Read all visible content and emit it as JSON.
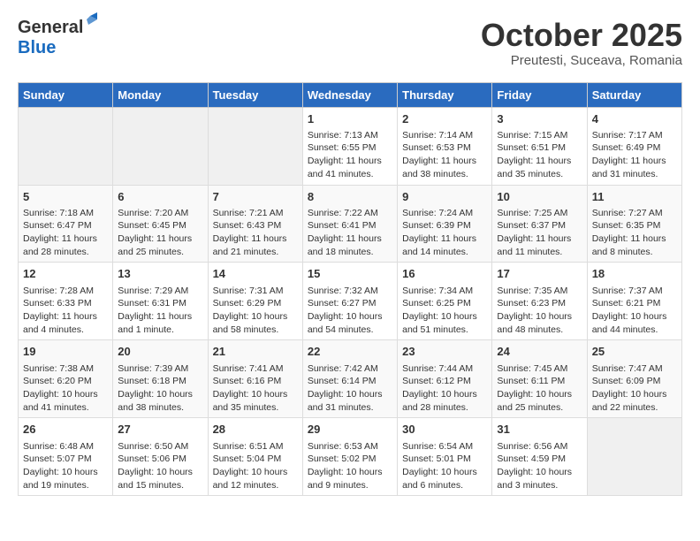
{
  "logo": {
    "general": "General",
    "blue": "Blue"
  },
  "title": "October 2025",
  "subtitle": "Preutesti, Suceava, Romania",
  "headers": [
    "Sunday",
    "Monday",
    "Tuesday",
    "Wednesday",
    "Thursday",
    "Friday",
    "Saturday"
  ],
  "weeks": [
    [
      {
        "day": "",
        "info": ""
      },
      {
        "day": "",
        "info": ""
      },
      {
        "day": "",
        "info": ""
      },
      {
        "day": "1",
        "info": "Sunrise: 7:13 AM\nSunset: 6:55 PM\nDaylight: 11 hours and 41 minutes."
      },
      {
        "day": "2",
        "info": "Sunrise: 7:14 AM\nSunset: 6:53 PM\nDaylight: 11 hours and 38 minutes."
      },
      {
        "day": "3",
        "info": "Sunrise: 7:15 AM\nSunset: 6:51 PM\nDaylight: 11 hours and 35 minutes."
      },
      {
        "day": "4",
        "info": "Sunrise: 7:17 AM\nSunset: 6:49 PM\nDaylight: 11 hours and 31 minutes."
      }
    ],
    [
      {
        "day": "5",
        "info": "Sunrise: 7:18 AM\nSunset: 6:47 PM\nDaylight: 11 hours and 28 minutes."
      },
      {
        "day": "6",
        "info": "Sunrise: 7:20 AM\nSunset: 6:45 PM\nDaylight: 11 hours and 25 minutes."
      },
      {
        "day": "7",
        "info": "Sunrise: 7:21 AM\nSunset: 6:43 PM\nDaylight: 11 hours and 21 minutes."
      },
      {
        "day": "8",
        "info": "Sunrise: 7:22 AM\nSunset: 6:41 PM\nDaylight: 11 hours and 18 minutes."
      },
      {
        "day": "9",
        "info": "Sunrise: 7:24 AM\nSunset: 6:39 PM\nDaylight: 11 hours and 14 minutes."
      },
      {
        "day": "10",
        "info": "Sunrise: 7:25 AM\nSunset: 6:37 PM\nDaylight: 11 hours and 11 minutes."
      },
      {
        "day": "11",
        "info": "Sunrise: 7:27 AM\nSunset: 6:35 PM\nDaylight: 11 hours and 8 minutes."
      }
    ],
    [
      {
        "day": "12",
        "info": "Sunrise: 7:28 AM\nSunset: 6:33 PM\nDaylight: 11 hours and 4 minutes."
      },
      {
        "day": "13",
        "info": "Sunrise: 7:29 AM\nSunset: 6:31 PM\nDaylight: 11 hours and 1 minute."
      },
      {
        "day": "14",
        "info": "Sunrise: 7:31 AM\nSunset: 6:29 PM\nDaylight: 10 hours and 58 minutes."
      },
      {
        "day": "15",
        "info": "Sunrise: 7:32 AM\nSunset: 6:27 PM\nDaylight: 10 hours and 54 minutes."
      },
      {
        "day": "16",
        "info": "Sunrise: 7:34 AM\nSunset: 6:25 PM\nDaylight: 10 hours and 51 minutes."
      },
      {
        "day": "17",
        "info": "Sunrise: 7:35 AM\nSunset: 6:23 PM\nDaylight: 10 hours and 48 minutes."
      },
      {
        "day": "18",
        "info": "Sunrise: 7:37 AM\nSunset: 6:21 PM\nDaylight: 10 hours and 44 minutes."
      }
    ],
    [
      {
        "day": "19",
        "info": "Sunrise: 7:38 AM\nSunset: 6:20 PM\nDaylight: 10 hours and 41 minutes."
      },
      {
        "day": "20",
        "info": "Sunrise: 7:39 AM\nSunset: 6:18 PM\nDaylight: 10 hours and 38 minutes."
      },
      {
        "day": "21",
        "info": "Sunrise: 7:41 AM\nSunset: 6:16 PM\nDaylight: 10 hours and 35 minutes."
      },
      {
        "day": "22",
        "info": "Sunrise: 7:42 AM\nSunset: 6:14 PM\nDaylight: 10 hours and 31 minutes."
      },
      {
        "day": "23",
        "info": "Sunrise: 7:44 AM\nSunset: 6:12 PM\nDaylight: 10 hours and 28 minutes."
      },
      {
        "day": "24",
        "info": "Sunrise: 7:45 AM\nSunset: 6:11 PM\nDaylight: 10 hours and 25 minutes."
      },
      {
        "day": "25",
        "info": "Sunrise: 7:47 AM\nSunset: 6:09 PM\nDaylight: 10 hours and 22 minutes."
      }
    ],
    [
      {
        "day": "26",
        "info": "Sunrise: 6:48 AM\nSunset: 5:07 PM\nDaylight: 10 hours and 19 minutes."
      },
      {
        "day": "27",
        "info": "Sunrise: 6:50 AM\nSunset: 5:06 PM\nDaylight: 10 hours and 15 minutes."
      },
      {
        "day": "28",
        "info": "Sunrise: 6:51 AM\nSunset: 5:04 PM\nDaylight: 10 hours and 12 minutes."
      },
      {
        "day": "29",
        "info": "Sunrise: 6:53 AM\nSunset: 5:02 PM\nDaylight: 10 hours and 9 minutes."
      },
      {
        "day": "30",
        "info": "Sunrise: 6:54 AM\nSunset: 5:01 PM\nDaylight: 10 hours and 6 minutes."
      },
      {
        "day": "31",
        "info": "Sunrise: 6:56 AM\nSunset: 4:59 PM\nDaylight: 10 hours and 3 minutes."
      },
      {
        "day": "",
        "info": ""
      }
    ]
  ]
}
